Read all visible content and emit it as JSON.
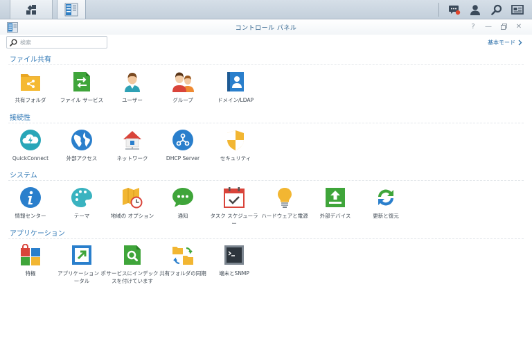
{
  "window": {
    "title": "コントロール パネル"
  },
  "taskbar": {
    "main_menu_icon": "main-menu-icon",
    "open_app_icon": "control-panel-icon",
    "right_icons": [
      "notification-icon",
      "user-icon",
      "search-icon",
      "widgets-icon"
    ]
  },
  "search": {
    "placeholder": "検索"
  },
  "mode_link": {
    "label": "基本モード"
  },
  "sections": [
    {
      "title": "ファイル共有",
      "items": [
        {
          "label": "共有フォルダ",
          "icon": "shared-folder-icon"
        },
        {
          "label": "ファイル サービス",
          "icon": "file-services-icon"
        },
        {
          "label": "ユーザー",
          "icon": "user-icon"
        },
        {
          "label": "グループ",
          "icon": "group-icon"
        },
        {
          "label": "ドメイン/LDAP",
          "icon": "domain-ldap-icon"
        }
      ]
    },
    {
      "title": "接続性",
      "items": [
        {
          "label": "QuickConnect",
          "icon": "quickconnect-icon"
        },
        {
          "label": "外部アクセス",
          "icon": "external-access-icon"
        },
        {
          "label": "ネットワーク",
          "icon": "network-icon"
        },
        {
          "label": "DHCP Server",
          "icon": "dhcp-server-icon"
        },
        {
          "label": "セキュリティ",
          "icon": "security-icon"
        }
      ]
    },
    {
      "title": "システム",
      "items": [
        {
          "label": "情報センター",
          "icon": "info-center-icon"
        },
        {
          "label": "テーマ",
          "icon": "theme-icon"
        },
        {
          "label": "地域の オプション",
          "icon": "regional-options-icon"
        },
        {
          "label": "通知",
          "icon": "notification-icon"
        },
        {
          "label": "タスク スケジューラー",
          "icon": "task-scheduler-icon"
        },
        {
          "label": "ハードウェアと電源",
          "icon": "hardware-power-icon"
        },
        {
          "label": "外部デバイス",
          "icon": "external-devices-icon"
        },
        {
          "label": "更新と復元",
          "icon": "update-restore-icon"
        }
      ]
    },
    {
      "title": "アプリケーション",
      "items": [
        {
          "label": "特権",
          "icon": "privileges-icon"
        },
        {
          "label": "アプリケーション ポータル",
          "icon": "application-portal-icon"
        },
        {
          "label": "サービスにインデックスを付けています",
          "icon": "indexing-service-icon"
        },
        {
          "label": "共有フォルダの同期",
          "icon": "shared-folder-sync-icon"
        },
        {
          "label": "端末とSNMP",
          "icon": "terminal-snmp-icon"
        }
      ]
    }
  ]
}
